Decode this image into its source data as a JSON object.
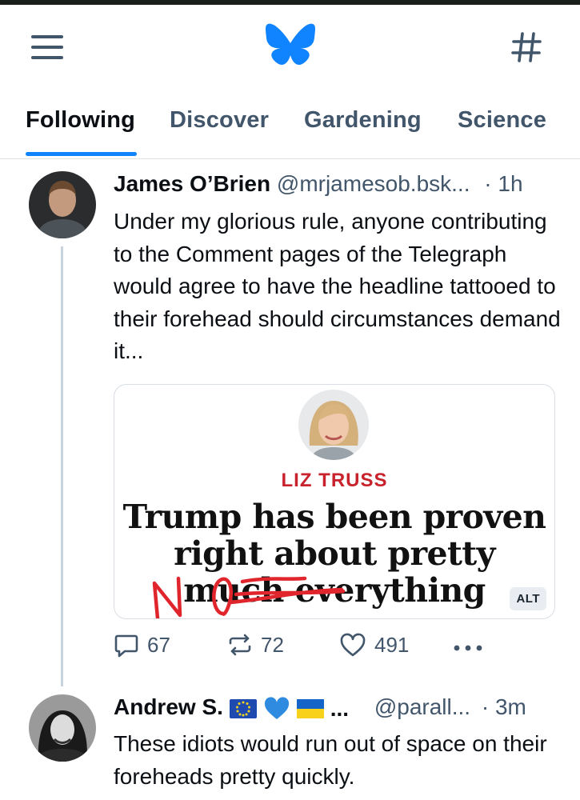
{
  "header": {
    "menu_icon": "hamburger-menu-icon",
    "logo_icon": "butterfly-logo",
    "feeds_icon": "hash-icon",
    "brand_color": "#1083fe"
  },
  "tabs": [
    {
      "label": "Following",
      "active": true
    },
    {
      "label": "Discover",
      "active": false
    },
    {
      "label": "Gardening",
      "active": false
    },
    {
      "label": "Science",
      "active": false
    }
  ],
  "posts": [
    {
      "author": "James O’Brien",
      "handle": "@mrjamesob.bsk...",
      "time": "· 1h",
      "text": "Under my glorious rule, anyone contributing to the Comment pages of the Telegraph would agree to have the headline tattooed to their forehead should circumstances demand it...",
      "embed": {
        "kicker": "LIZ TRUSS",
        "headline": "Trump has been proven right about pretty much everything",
        "annotation": "NO",
        "alt_label": "ALT"
      },
      "stats": {
        "replies": "67",
        "reposts": "72",
        "likes": "491"
      }
    },
    {
      "author": "Andrew S.",
      "author_suffix": "...",
      "flags": [
        "eu-flag-icon",
        "blue-heart-icon",
        "ukraine-flag-icon"
      ],
      "handle": "@parall...",
      "time": "· 3m",
      "text": "These idiots would run out of space on their foreheads pretty quickly."
    }
  ]
}
